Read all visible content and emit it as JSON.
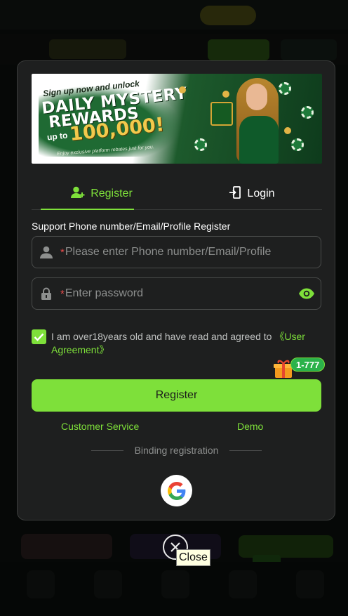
{
  "banner": {
    "line1": "Sign up now and unlock",
    "line2": "DAILY MYSTERY",
    "line3": "REWARDS",
    "line4": "up to",
    "amount": "100,000!",
    "fine_print": "Enjoy exclusive platform rebates just for you."
  },
  "tabs": {
    "register": "Register",
    "login": "Login"
  },
  "form": {
    "hint": "Support Phone number/Email/Profile Register",
    "required_mark": "*",
    "username_placeholder": "Please enter Phone number/Email/Profile",
    "username_value": "",
    "password_placeholder": "Enter password",
    "password_value": ""
  },
  "agreement": {
    "checked": true,
    "text": "I am over18years old and have read and agreed to ",
    "link": "《User Agreement》"
  },
  "gift_badge": "1-777",
  "register_button": "Register",
  "links": {
    "customer_service": "Customer Service",
    "demo": "Demo"
  },
  "binding_label": "Binding registration",
  "tooltip": "Close",
  "colors": {
    "accent": "#7ee03a",
    "modal_bg": "#1e1f1f",
    "required": "#e24b4b",
    "badge": "#2bb24a"
  },
  "icons": {
    "user_tab": "add-user-icon",
    "login_tab": "login-icon",
    "username_field": "user-icon",
    "password_field": "lock-icon",
    "password_toggle": "eye-icon",
    "social": "google-icon",
    "close": "close-icon",
    "gift": "gift-icon"
  }
}
